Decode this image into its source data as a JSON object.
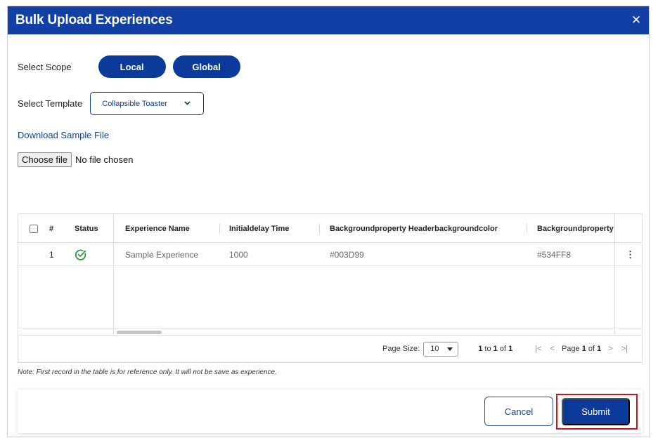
{
  "modal": {
    "title": "Bulk Upload Experiences",
    "close_icon": "close-icon"
  },
  "scope": {
    "label": "Select Scope",
    "options": [
      "Local",
      "Global"
    ]
  },
  "template": {
    "label": "Select Template",
    "selected": "Collapsible Toaster",
    "icon": "chevron-down-icon"
  },
  "download_link": "Download Sample File",
  "file_input": {
    "button_label": "Choose file",
    "status": "No file chosen"
  },
  "table": {
    "columns": [
      "#",
      "Status",
      "Experience Name",
      "Initialdelay Time",
      "Backgroundproperty Headerbackgroundcolor",
      "Backgroundproperty"
    ],
    "rows": [
      {
        "num": "1",
        "status_icon": "check-circle-icon",
        "experience_name": "Sample Experience",
        "initial_delay": "1000",
        "header_bg_color": "#003D99",
        "bg_property": "#534FF8",
        "menu_icon": "more-vertical-icon"
      }
    ],
    "footer": {
      "page_size_label": "Page Size:",
      "page_size_value": "10",
      "range_from": "1",
      "range_to_word": "to",
      "range_to": "1",
      "range_of_word": "of",
      "range_total": "1",
      "page_word": "Page",
      "page_current": "1",
      "page_of_word": "of",
      "page_total": "1"
    }
  },
  "note": "Note: First record in the table is for reference only. It will not be save as experience.",
  "actions": {
    "cancel": "Cancel",
    "submit": "Submit"
  },
  "colors": {
    "header_bg": "#123fa6",
    "primary": "#0c3a9a",
    "success": "#2e9a3c",
    "highlight": "#d0141c"
  }
}
